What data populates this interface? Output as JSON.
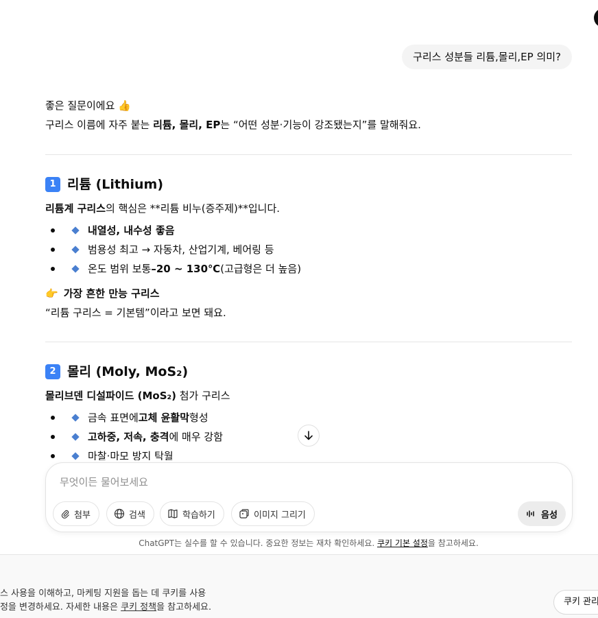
{
  "user_message": "구리스 성분들 리튬,몰리,EP 의미?",
  "answer": {
    "intro_line1": "좋은 질문이에요 👍",
    "intro_line2_prefix": "구리스 이름에 자주 붙는 ",
    "intro_line2_bold": "리튬, 몰리, EP",
    "intro_line2_suffix": "는 “어떤 성분·기능이 강조됐는지”를 말해줘요.",
    "section1": {
      "number": "1",
      "title_kr": "리튬",
      "title_latin": "(Lithium)",
      "lead_bold": "리튬계 구리스",
      "lead_rest": "의 핵심은 **리튬 비누(증주제)**입니다.",
      "bullets": [
        {
          "bold": "내열성, 내수성 좋음",
          "rest": ""
        },
        {
          "bold": "",
          "rest": "범용성 최고 → 자동차, 산업기계, 베어링 등"
        },
        {
          "pre": "온도 범위 보통 ",
          "bold": "–20 ~ 130℃",
          "rest": " (고급형은 더 높음)"
        }
      ],
      "note_bold": "가장 흔한 만능 구리스",
      "note_line": "“리튬 구리스 = 기본템”이라고 보면 돼요."
    },
    "section2": {
      "number": "2",
      "title_kr": "몰리",
      "title_latin": "(Moly, MoS₂)",
      "lead_bold": "몰리브덴 디설파이드 (MoS₂)",
      "lead_rest": " 첨가 구리스",
      "bullets": [
        {
          "pre": "금속 표면에 ",
          "bold": "고체 윤활막",
          "rest": " 형성"
        },
        {
          "pre": "",
          "bold": "고하중, 저속, 충격",
          "rest": "에 매우 강함"
        },
        {
          "pre": "",
          "bold": "",
          "rest": "마찰·마모 방지 탁월"
        }
      ]
    }
  },
  "composer": {
    "placeholder": "무엇이든 물어보세요",
    "attach_label": "첨부",
    "search_label": "검색",
    "study_label": "학습하기",
    "image_label": "이미지 그리기",
    "voice_label": "음성"
  },
  "disclaimer": {
    "prefix": "ChatGPT는 실수를 할 수 있습니다. 중요한 정보는 재차 확인하세요. ",
    "link": "쿠키 기본 설정",
    "suffix": "을 참고하세요."
  },
  "cookie_banner": {
    "line1": "비스 사용을 이해하고, 마케팅 지원을 돕는 데 쿠키를 사용",
    "line2_prefix": "설정을 변경하세요. 자세한 내용은 ",
    "line2_link": "쿠키 정책",
    "line2_suffix": "을 참고하세요.",
    "button_label": "쿠키 관리"
  },
  "colors": {
    "accent_blue": "#3b82f6",
    "diamond_blue": "#4a7fd0",
    "bubble_bg": "#f4f4f4"
  }
}
